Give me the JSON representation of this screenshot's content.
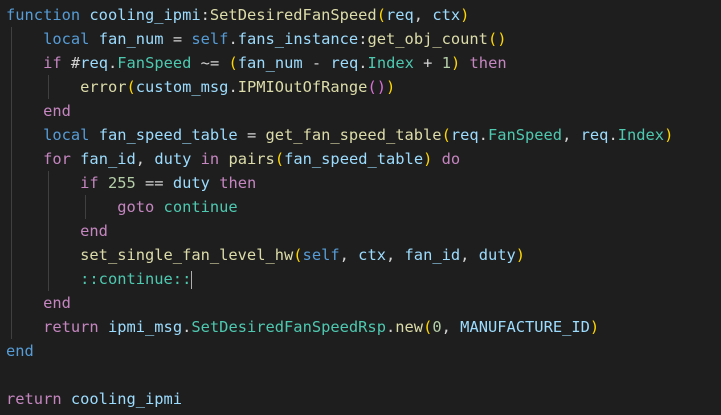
{
  "editor": {
    "colors": {
      "background": "#1e1e1e",
      "keyword": "#c586c0",
      "declaration": "#569cd6",
      "function": "#dcdcaa",
      "variable": "#9cdcfe",
      "number": "#b5cea8",
      "field": "#4ec9b0"
    },
    "lines": [
      [
        {
          "t": "function",
          "c": "dec"
        },
        {
          "t": " cooling_ipmi",
          "c": "var"
        },
        {
          "t": ":",
          "c": "pl"
        },
        {
          "t": "SetDesiredFanSpeed",
          "c": "fn"
        },
        {
          "t": "(",
          "c": "b1"
        },
        {
          "t": "req",
          "c": "var"
        },
        {
          "t": ", ",
          "c": "pl"
        },
        {
          "t": "ctx",
          "c": "var"
        },
        {
          "t": ")",
          "c": "b1"
        }
      ],
      [
        {
          "t": "    "
        },
        {
          "t": "local",
          "c": "dec"
        },
        {
          "t": " fan_num",
          "c": "var"
        },
        {
          "t": " = ",
          "c": "op"
        },
        {
          "t": "self",
          "c": "dec"
        },
        {
          "t": ".",
          "c": "pl"
        },
        {
          "t": "fans_instance",
          "c": "var"
        },
        {
          "t": ":",
          "c": "pl"
        },
        {
          "t": "get_obj_count",
          "c": "fn"
        },
        {
          "t": "()",
          "c": "b1"
        }
      ],
      [
        {
          "t": "    "
        },
        {
          "t": "if",
          "c": "kw"
        },
        {
          "t": " #",
          "c": "op"
        },
        {
          "t": "req",
          "c": "var"
        },
        {
          "t": ".",
          "c": "pl"
        },
        {
          "t": "FanSpeed",
          "c": "fld"
        },
        {
          "t": " ~= ",
          "c": "op"
        },
        {
          "t": "(",
          "c": "b1"
        },
        {
          "t": "fan_num",
          "c": "var"
        },
        {
          "t": " - ",
          "c": "op"
        },
        {
          "t": "req",
          "c": "var"
        },
        {
          "t": ".",
          "c": "pl"
        },
        {
          "t": "Index",
          "c": "fld"
        },
        {
          "t": " + ",
          "c": "op"
        },
        {
          "t": "1",
          "c": "num"
        },
        {
          "t": ")",
          "c": "b1"
        },
        {
          "t": " then",
          "c": "kw"
        }
      ],
      [
        {
          "t": "        "
        },
        {
          "t": "error",
          "c": "fn"
        },
        {
          "t": "(",
          "c": "b1"
        },
        {
          "t": "custom_msg",
          "c": "var"
        },
        {
          "t": ".",
          "c": "pl"
        },
        {
          "t": "IPMIOutOfRange",
          "c": "fn"
        },
        {
          "t": "()",
          "c": "b2"
        },
        {
          "t": ")",
          "c": "b1"
        }
      ],
      [
        {
          "t": "    "
        },
        {
          "t": "end",
          "c": "kw"
        }
      ],
      [
        {
          "t": "    "
        },
        {
          "t": "local",
          "c": "dec"
        },
        {
          "t": " fan_speed_table",
          "c": "var"
        },
        {
          "t": " = ",
          "c": "op"
        },
        {
          "t": "get_fan_speed_table",
          "c": "fn"
        },
        {
          "t": "(",
          "c": "b1"
        },
        {
          "t": "req",
          "c": "var"
        },
        {
          "t": ".",
          "c": "pl"
        },
        {
          "t": "FanSpeed",
          "c": "fld"
        },
        {
          "t": ", ",
          "c": "pl"
        },
        {
          "t": "req",
          "c": "var"
        },
        {
          "t": ".",
          "c": "pl"
        },
        {
          "t": "Index",
          "c": "fld"
        },
        {
          "t": ")",
          "c": "b1"
        }
      ],
      [
        {
          "t": "    "
        },
        {
          "t": "for",
          "c": "kw"
        },
        {
          "t": " fan_id",
          "c": "var"
        },
        {
          "t": ", ",
          "c": "pl"
        },
        {
          "t": "duty",
          "c": "var"
        },
        {
          "t": " in ",
          "c": "kw"
        },
        {
          "t": "pairs",
          "c": "fn"
        },
        {
          "t": "(",
          "c": "b1"
        },
        {
          "t": "fan_speed_table",
          "c": "var"
        },
        {
          "t": ")",
          "c": "b1"
        },
        {
          "t": " do",
          "c": "kw"
        }
      ],
      [
        {
          "t": "        "
        },
        {
          "t": "if",
          "c": "kw"
        },
        {
          "t": " 255",
          "c": "num"
        },
        {
          "t": " == ",
          "c": "op"
        },
        {
          "t": "duty",
          "c": "var"
        },
        {
          "t": " then",
          "c": "kw"
        }
      ],
      [
        {
          "t": "            "
        },
        {
          "t": "goto",
          "c": "kw"
        },
        {
          "t": " continue",
          "c": "lbl"
        }
      ],
      [
        {
          "t": "        "
        },
        {
          "t": "end",
          "c": "kw"
        }
      ],
      [
        {
          "t": "        "
        },
        {
          "t": "set_single_fan_level_hw",
          "c": "fn"
        },
        {
          "t": "(",
          "c": "b1"
        },
        {
          "t": "self",
          "c": "dec"
        },
        {
          "t": ", ",
          "c": "pl"
        },
        {
          "t": "ctx",
          "c": "var"
        },
        {
          "t": ", ",
          "c": "pl"
        },
        {
          "t": "fan_id",
          "c": "var"
        },
        {
          "t": ", ",
          "c": "pl"
        },
        {
          "t": "duty",
          "c": "var"
        },
        {
          "t": ")",
          "c": "b1"
        }
      ],
      [
        {
          "t": "        "
        },
        {
          "t": "::continue::",
          "c": "lbl"
        }
      ],
      [
        {
          "t": "    "
        },
        {
          "t": "end",
          "c": "kw"
        }
      ],
      [
        {
          "t": "    "
        },
        {
          "t": "return",
          "c": "kw"
        },
        {
          "t": " ipmi_msg",
          "c": "var"
        },
        {
          "t": ".",
          "c": "pl"
        },
        {
          "t": "SetDesiredFanSpeedRsp",
          "c": "fld"
        },
        {
          "t": ".",
          "c": "pl"
        },
        {
          "t": "new",
          "c": "fn"
        },
        {
          "t": "(",
          "c": "b1"
        },
        {
          "t": "0",
          "c": "num"
        },
        {
          "t": ", ",
          "c": "pl"
        },
        {
          "t": "MANUFACTURE_ID",
          "c": "var"
        },
        {
          "t": ")",
          "c": "b1"
        }
      ],
      [
        {
          "t": "end",
          "c": "dec"
        }
      ],
      [],
      [
        {
          "t": "return",
          "c": "kw"
        },
        {
          "t": " cooling_ipmi",
          "c": "var"
        }
      ]
    ]
  }
}
